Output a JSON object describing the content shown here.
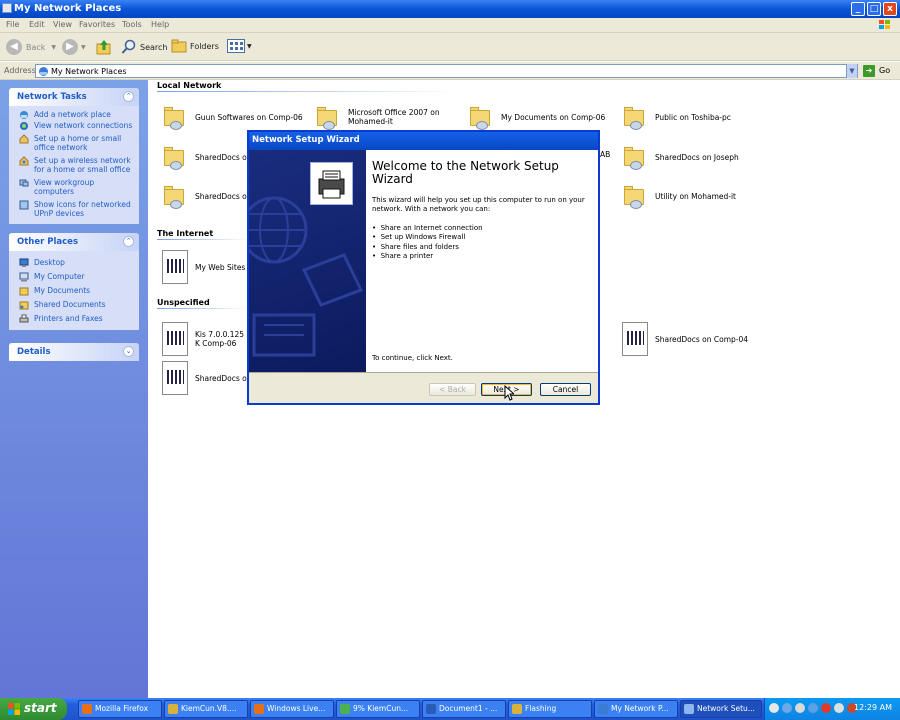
{
  "window": {
    "title": "My Network Places",
    "controls": {
      "minimize": "_",
      "maximize": "□",
      "close": "x"
    }
  },
  "menubar": [
    "File",
    "Edit",
    "View",
    "Favorites",
    "Tools",
    "Help"
  ],
  "toolbar": {
    "back": "Back",
    "search": "Search",
    "folders": "Folders"
  },
  "address": {
    "label": "Address",
    "value": "My Network Places",
    "go": "Go"
  },
  "left_panel": {
    "network_tasks": {
      "title": "Network Tasks",
      "items": [
        "Add a network place",
        "View network connections",
        "Set up a home or small office network",
        "Set up a wireless network for a home or small office",
        "View workgroup computers",
        "Show icons for networked UPnP devices"
      ]
    },
    "other_places": {
      "title": "Other Places",
      "items": [
        "Desktop",
        "My Computer",
        "My Documents",
        "Shared Documents",
        "Printers and Faxes"
      ]
    },
    "details": {
      "title": "Details"
    }
  },
  "main": {
    "groups": {
      "local_network": "Local Network",
      "internet": "The Internet",
      "unspecified": "Unspecified"
    },
    "local_items": [
      "Guun Softwares on Comp-06",
      "Microsoft Office 2007 on Mohamed-it",
      "My Documents on Comp-06",
      "Public on Toshiba-pc",
      "SharedDocs on",
      "AB",
      "SharedDocs on Joseph",
      "SharedDocs on",
      "Utility on Mohamed-it"
    ],
    "internet_items": [
      "My Web Sites o"
    ],
    "unspecified_items": [
      "Kis 7.0.0.125 K Comp-06",
      "SharedDocs on",
      "SharedDocs on Comp-04"
    ]
  },
  "dialog": {
    "title": "Network Setup Wizard",
    "heading": "Welcome to the Network Setup Wizard",
    "intro": "This wizard will help you set up this computer to run on your network. With a network you can:",
    "bullets": [
      "Share an Internet connection",
      "Set up Windows Firewall",
      "Share files and folders",
      "Share a printer"
    ],
    "continue_text": "To continue, click Next.",
    "buttons": {
      "back": "< Back",
      "next": "Next >",
      "cancel": "Cancel"
    }
  },
  "taskbar": {
    "start": "start",
    "buttons": [
      "Mozilla Firefox",
      "KiemCun.V8....",
      "Windows Live...",
      "9% KiemCun...",
      "Document1 - ...",
      "Flashing",
      "My Network P...",
      "Network Setu..."
    ],
    "clock": "12:29 AM"
  },
  "colors": {
    "titlebar": "#0a55d8",
    "taskpanel": "#6375d6",
    "start_green": "#3c9a3c",
    "link_blue": "#215dc6"
  }
}
